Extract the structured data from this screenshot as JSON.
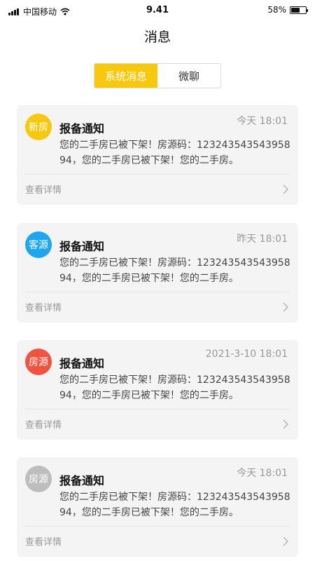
{
  "status_bar": {
    "carrier": "中国移动",
    "time": "9.41",
    "battery": "58%",
    "battery_level": 0.58
  },
  "page": {
    "title": "消息"
  },
  "tabs": [
    {
      "label": "系统消息",
      "active": true
    },
    {
      "label": "微聊",
      "active": false
    }
  ],
  "messages": [
    {
      "tag": "新房",
      "tag_color": "#F8C80C",
      "title": "报备通知",
      "time": "今天 18:01",
      "body": "您的二手房已被下架！房源码：12324354354395894，您的二手房已被下架！您的二手房。",
      "action": "查看详情"
    },
    {
      "tag": "客源",
      "tag_color": "#1EA7F0",
      "title": "报备通知",
      "time": "昨天 18:01",
      "body": "您的二手房已被下架！房源码：12324354354395894，您的二手房已被下架！您的二手房。",
      "action": "查看详情"
    },
    {
      "tag": "房源",
      "tag_color": "#F2533F",
      "title": "报备通知",
      "time": "2021-3-10 18:01",
      "body": "您的二手房已被下架！房源码：12324354354395894，您的二手房已被下架！您的二手房。",
      "action": "查看详情"
    },
    {
      "tag": "房源",
      "tag_color": "#BDBDBD",
      "title": "报备通知",
      "time": "今天 18:01",
      "body": "您的二手房已被下架！房源码：12324354354395894，您的二手房已被下架！您的二手房。",
      "action": "查看详情"
    }
  ]
}
